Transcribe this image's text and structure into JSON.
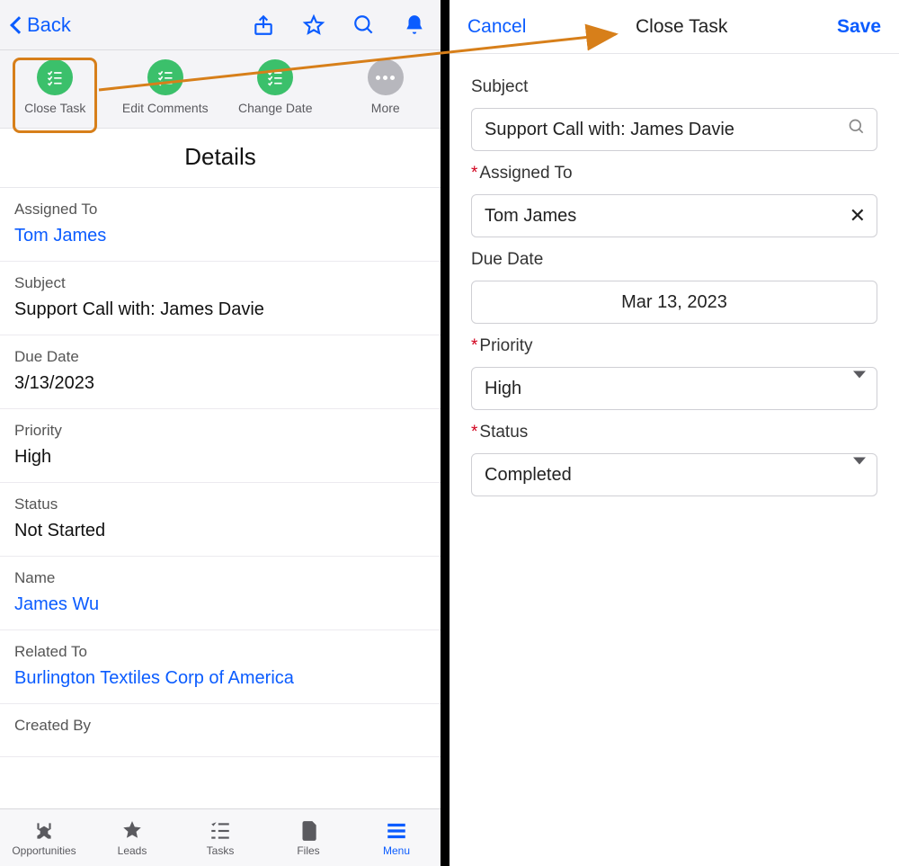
{
  "left": {
    "back_label": "Back",
    "actions": [
      {
        "label": "Close Task"
      },
      {
        "label": "Edit Comments"
      },
      {
        "label": "Change Date"
      },
      {
        "label": "More"
      }
    ],
    "details_title": "Details",
    "rows": [
      {
        "label": "Assigned To",
        "value": "Tom James",
        "link": true
      },
      {
        "label": "Subject",
        "value": "Support Call with: James Davie",
        "link": false
      },
      {
        "label": "Due Date",
        "value": "3/13/2023",
        "link": false
      },
      {
        "label": "Priority",
        "value": "High",
        "link": false
      },
      {
        "label": "Status",
        "value": "Not Started",
        "link": false
      },
      {
        "label": "Name",
        "value": "James Wu",
        "link": true
      },
      {
        "label": "Related To",
        "value": "Burlington Textiles Corp of America",
        "link": true
      },
      {
        "label": "Created By",
        "value": "",
        "link": false
      }
    ],
    "tabs": [
      {
        "label": "Opportunities"
      },
      {
        "label": "Leads"
      },
      {
        "label": "Tasks"
      },
      {
        "label": "Files"
      },
      {
        "label": "Menu"
      }
    ]
  },
  "right": {
    "cancel": "Cancel",
    "title": "Close Task",
    "save": "Save",
    "fields": {
      "subject_label": "Subject",
      "subject_value": "Support Call with: James Davie",
      "assigned_label": "Assigned To",
      "assigned_value": "Tom James",
      "due_label": "Due Date",
      "due_value": "Mar 13, 2023",
      "priority_label": "Priority",
      "priority_value": "High",
      "status_label": "Status",
      "status_value": "Completed"
    }
  }
}
